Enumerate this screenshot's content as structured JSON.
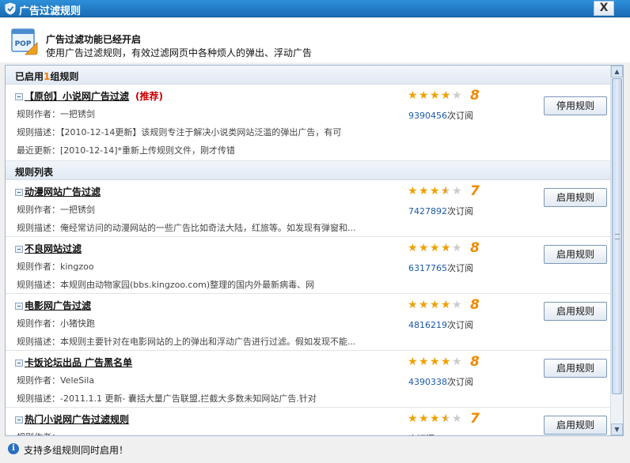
{
  "window": {
    "title": "广告过滤规则",
    "close_label": "X"
  },
  "header": {
    "title": "广告过滤功能已经开启",
    "desc": "使用广告过滤规则，有效过滤网页中各种烦人的弹出、浮动广告",
    "icon_text": "POP"
  },
  "enabled_section": {
    "prefix": "已启用",
    "count": "1",
    "suffix": "组规则"
  },
  "list_section": {
    "title": "规则列表"
  },
  "labels": {
    "author": "规则作者：",
    "desc": "规则描述：",
    "update": "最近更新：",
    "subs_suffix": "次订阅"
  },
  "enabled_rules": [
    {
      "name": "【原创】小说网广告过滤",
      "recommend": "(推荐)",
      "author": "一把锈剑",
      "desc": "【2010-12-14更新】该规则专注于解决小说类网站泛滥的弹出广告，有可",
      "update": "[2010-12-14]*重新上传规则文件，刚才传错",
      "stars": 4,
      "score": "8",
      "subs": "9390456",
      "button": "停用规则"
    }
  ],
  "rules": [
    {
      "name": "动漫网站广告过滤",
      "author": "一把锈剑",
      "desc": "俺经常访问的动漫网站的一些广告比如奇法大陆，红旅等。如发现有弹窗和...",
      "stars": 3.5,
      "score": "7",
      "subs": "7427892",
      "button": "启用规则"
    },
    {
      "name": "不良网站过滤",
      "author": "kingzoo",
      "desc": "本规则由动物家园(bbs.kingzoo.com)整理的国内外最新病毒、网",
      "stars": 4,
      "score": "8",
      "subs": "6317765",
      "button": "启用规则"
    },
    {
      "name": "电影网广告过滤",
      "author": "小猪快跑",
      "desc": "本规则主要针对在电影网站的上的弹出和浮动广告进行过滤。假如发现不能...",
      "stars": 4,
      "score": "8",
      "subs": "4816219",
      "button": "启用规则"
    },
    {
      "name": "卡饭论坛出品 广告黑名单",
      "author": "VeleSila",
      "desc": "-2011.1.1 更新- 囊括大量广告联盟,拦截大多数未知网站广告.针对",
      "stars": 4,
      "score": "8",
      "subs": "4390338",
      "button": "启用规则"
    },
    {
      "name": "热门小说网广告过滤规则",
      "author": "",
      "desc": "",
      "stars": 3.5,
      "score": "7",
      "subs": "",
      "button": "启用规则"
    }
  ],
  "footer": {
    "text": "支持多组规则同时启用！"
  }
}
